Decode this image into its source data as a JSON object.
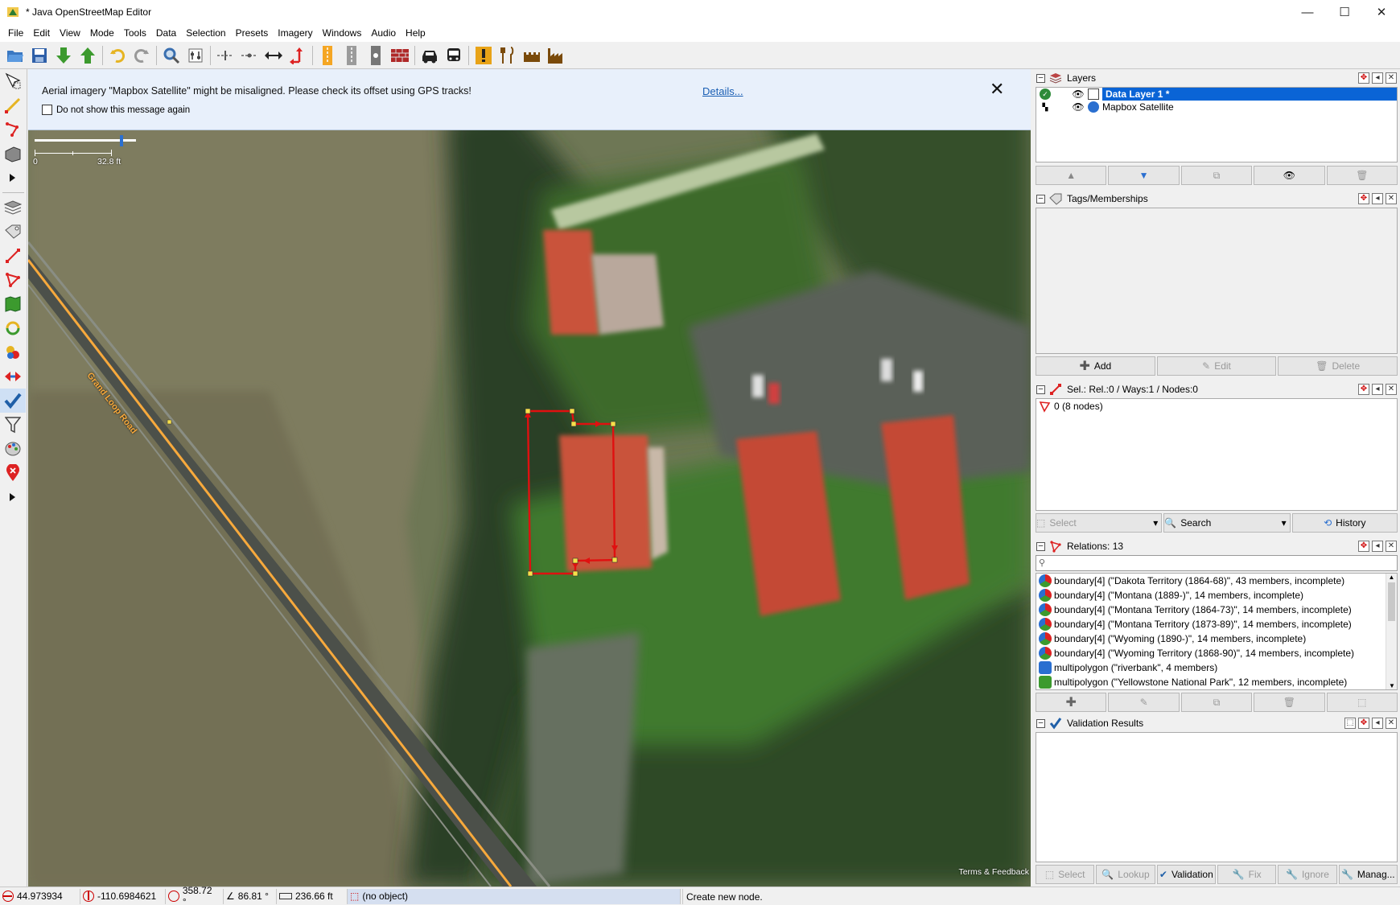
{
  "window": {
    "title": "* Java OpenStreetMap Editor",
    "minimize": "—",
    "maximize": "☐",
    "close": "✕"
  },
  "menu": [
    "File",
    "Edit",
    "View",
    "Mode",
    "Tools",
    "Data",
    "Selection",
    "Presets",
    "Imagery",
    "Windows",
    "Audio",
    "Help"
  ],
  "notice": {
    "message": "Aerial imagery \"Mapbox Satellite\" might be misaligned. Please check its offset using GPS tracks!",
    "details_link": "Details...",
    "checkbox_label": "Do not show this message again",
    "close": "✕"
  },
  "scale": {
    "zero": "0",
    "distance": "32.8 ft"
  },
  "map": {
    "road_label": "Grand Loop Road",
    "terms": "Terms & Feedback"
  },
  "layers": {
    "title": "Layers",
    "items": [
      {
        "name": "Data Layer 1 *",
        "selected": true
      },
      {
        "name": "Mapbox Satellite",
        "selected": false
      }
    ]
  },
  "tags": {
    "title": "Tags/Memberships",
    "add": "Add",
    "edit": "Edit",
    "delete": "Delete"
  },
  "selection": {
    "title": "Sel.: Rel.:0 / Ways:1 / Nodes:0",
    "item": "0 (8 nodes)",
    "select": "Select",
    "search": "Search",
    "history": "History"
  },
  "relations": {
    "title": "Relations: 13",
    "items": [
      {
        "text": "boundary[4] (\"Dakota Territory (1864-68)\", 43 members, incomplete)",
        "kind": "boundary"
      },
      {
        "text": "boundary[4] (\"Montana (1889-)\", 14 members, incomplete)",
        "kind": "boundary"
      },
      {
        "text": "boundary[4] (\"Montana Territory (1864-73)\", 14 members, incomplete)",
        "kind": "boundary"
      },
      {
        "text": "boundary[4] (\"Montana Territory (1873-89)\", 14 members, incomplete)",
        "kind": "boundary"
      },
      {
        "text": "boundary[4] (\"Wyoming (1890-)\", 14 members, incomplete)",
        "kind": "boundary"
      },
      {
        "text": "boundary[4] (\"Wyoming Territory (1868-90)\", 14 members, incomplete)",
        "kind": "boundary"
      },
      {
        "text": "multipolygon (\"riverbank\", 4 members)",
        "kind": "water"
      },
      {
        "text": "multipolygon (\"Yellowstone National Park\", 12 members, incomplete)",
        "kind": "park"
      }
    ]
  },
  "validation": {
    "title": "Validation Results",
    "select": "Select",
    "lookup": "Lookup",
    "validation": "Validation",
    "fix": "Fix",
    "ignore": "Ignore",
    "manage": "Manag..."
  },
  "status": {
    "lat": "44.973934",
    "lon": "-110.6984621",
    "heading": "358.72 °",
    "angle": "86.81 °",
    "length": "236.66 ft",
    "object": "(no object)",
    "help": "Create new node."
  },
  "colors": {
    "selection_red": "#e01010",
    "road_orange": "#f7a93c",
    "roof": "#c9533a",
    "notice_bg": "#e8f0fb",
    "layer_selected": "#0a64d6"
  }
}
